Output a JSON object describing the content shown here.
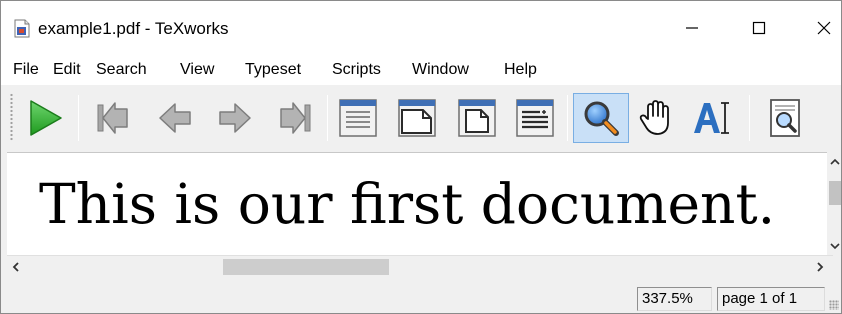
{
  "window": {
    "title": "example1.pdf - TeXworks",
    "icon": "pdf-document-icon",
    "controls": [
      "minimize-icon",
      "maximize-icon",
      "close-icon"
    ]
  },
  "menubar": {
    "items": [
      "File",
      "Edit",
      "Search",
      "View",
      "Typeset",
      "Scripts",
      "Window",
      "Help"
    ]
  },
  "toolbar": {
    "buttons": [
      {
        "icon": "typeset-play-icon"
      },
      {
        "icon": "first-page-icon"
      },
      {
        "icon": "previous-page-icon"
      },
      {
        "icon": "next-page-icon"
      },
      {
        "icon": "last-page-icon"
      },
      {
        "icon": "actual-size-icon"
      },
      {
        "icon": "fit-width-icon"
      },
      {
        "icon": "fit-window-icon"
      },
      {
        "icon": "fit-content-width-icon"
      },
      {
        "icon": "magnify-icon",
        "active": true
      },
      {
        "icon": "scroll-hand-icon"
      },
      {
        "icon": "select-text-icon"
      },
      {
        "icon": "find-in-pdf-icon"
      }
    ]
  },
  "document": {
    "text": "This is our first document."
  },
  "scroll": {
    "horizontal_thumb_fraction": 0.2,
    "vertical_thumb_fraction": 0.3
  },
  "statusbar": {
    "zoom": "337.5%",
    "page": "page 1 of 1"
  },
  "colors": {
    "play_green": "#3cb33c",
    "active_tool_bg": "#c9e0f7",
    "active_tool_border": "#79aee3",
    "text_tool_blue": "#2c6fc0"
  }
}
